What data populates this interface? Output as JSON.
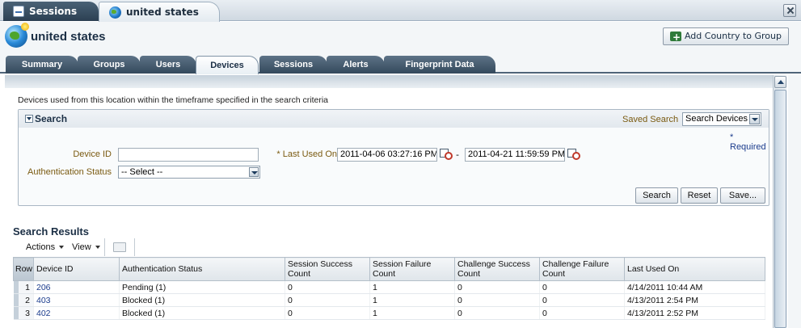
{
  "doc_tabs": [
    {
      "label": "Sessions"
    },
    {
      "label": "united states"
    }
  ],
  "header": {
    "title": "united states",
    "add_country_label": "Add Country to Group"
  },
  "tabs": [
    {
      "label": "Summary"
    },
    {
      "label": "Groups"
    },
    {
      "label": "Users"
    },
    {
      "label": "Devices",
      "active": true
    },
    {
      "label": "Sessions"
    },
    {
      "label": "Alerts"
    },
    {
      "label": "Fingerprint Data"
    }
  ],
  "description": "Devices used from this location within the timeframe specified in the search criteria",
  "search": {
    "title": "Search",
    "saved_search_label": "Saved Search",
    "saved_search_value": "Search Devices",
    "required_note": "* Required",
    "device_id_label": "Device ID",
    "device_id_value": "",
    "last_used_label": "* Last Used On",
    "date_from": "2011-04-06 03:27:16 PM",
    "date_to": "2011-04-21 11:59:59 PM",
    "date_separator": "-",
    "auth_status_label": "Authentication Status",
    "auth_status_value": "-- Select --",
    "buttons": {
      "search": "Search",
      "reset": "Reset",
      "save": "Save..."
    }
  },
  "results": {
    "title": "Search Results",
    "toolbar": {
      "actions": "Actions",
      "view": "View"
    },
    "columns": [
      "Row",
      "Device ID",
      "Authentication Status",
      "Session Success Count",
      "Session Failure Count",
      "Challenge Success Count",
      "Challenge Failure Count",
      "Last Used On"
    ],
    "rows": [
      {
        "row": "1",
        "device_id": "206",
        "auth_status": "Pending (1)",
        "session_success": "0",
        "session_failure": "1",
        "challenge_success": "0",
        "challenge_failure": "0",
        "last_used": "4/14/2011 10:44 AM"
      },
      {
        "row": "2",
        "device_id": "403",
        "auth_status": "Blocked (1)",
        "session_success": "0",
        "session_failure": "1",
        "challenge_success": "0",
        "challenge_failure": "0",
        "last_used": "4/13/2011 2:54 PM"
      },
      {
        "row": "3",
        "device_id": "402",
        "auth_status": "Blocked (1)",
        "session_success": "0",
        "session_failure": "1",
        "challenge_success": "0",
        "challenge_failure": "0",
        "last_used": "4/13/2011 2:52 PM"
      }
    ]
  },
  "colors": {
    "tab_dark": "#34495c",
    "link": "#1a3b8c",
    "label": "#7a5a10"
  }
}
